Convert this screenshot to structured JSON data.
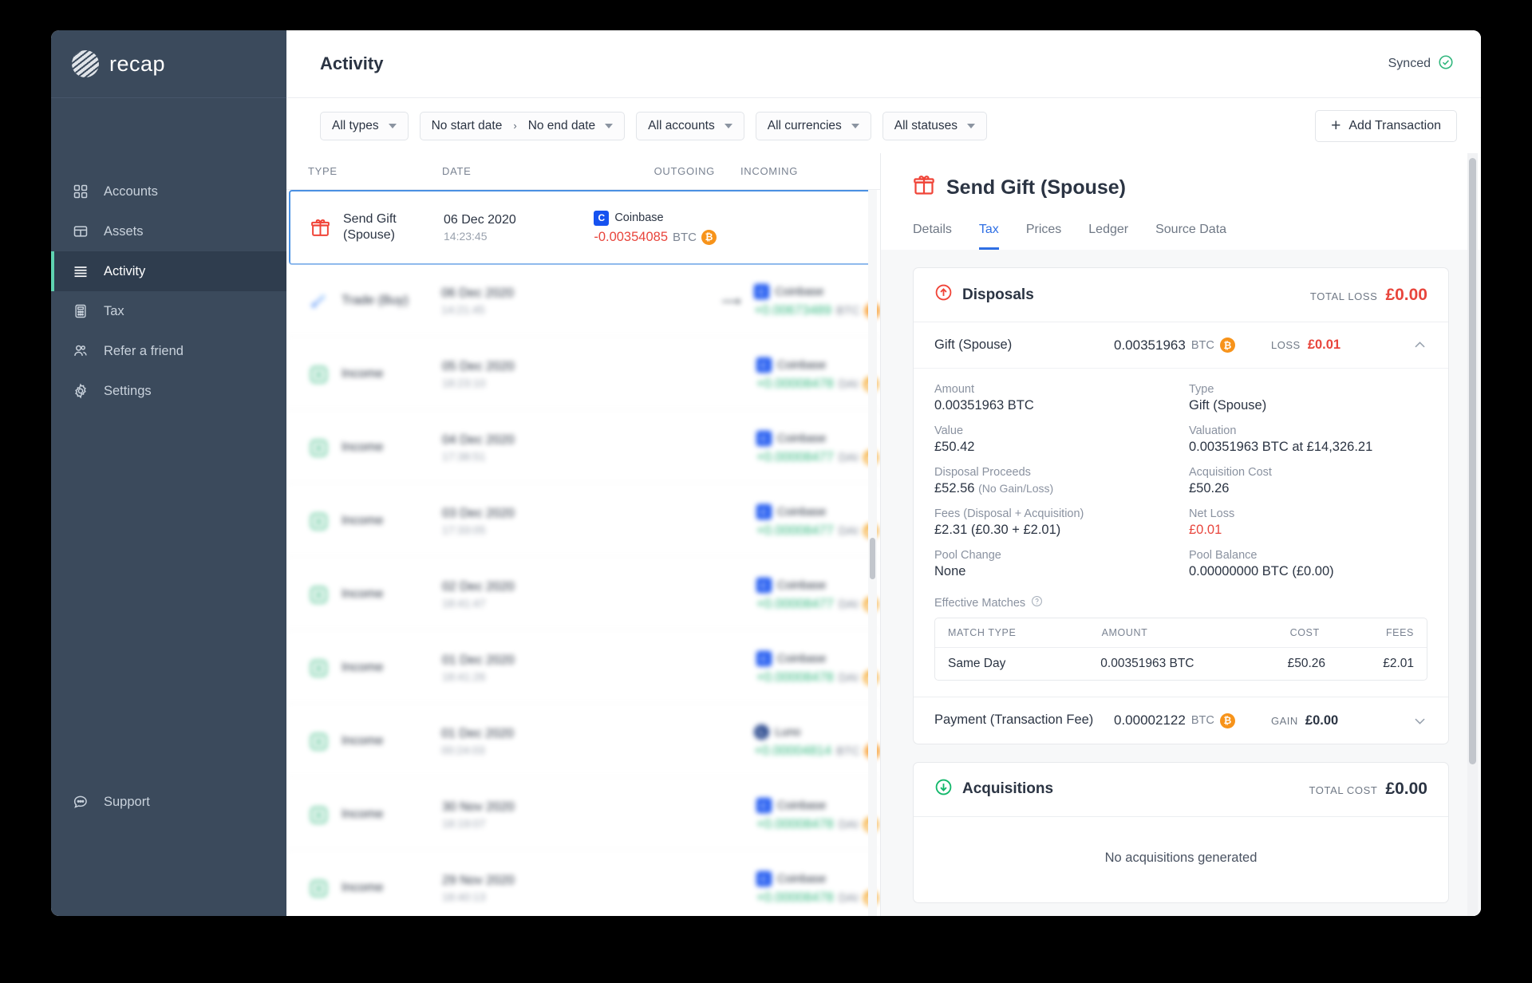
{
  "brand": {
    "name": "recap"
  },
  "sidebar": {
    "items": [
      {
        "label": "Accounts",
        "icon": "grid-icon",
        "active": false
      },
      {
        "label": "Assets",
        "icon": "table-icon",
        "active": false
      },
      {
        "label": "Activity",
        "icon": "list-icon",
        "active": true
      },
      {
        "label": "Tax",
        "icon": "calculator-icon",
        "active": false
      },
      {
        "label": "Refer a friend",
        "icon": "users-icon",
        "active": false
      },
      {
        "label": "Settings",
        "icon": "gear-icon",
        "active": false
      }
    ],
    "support": {
      "label": "Support",
      "icon": "chat-icon"
    }
  },
  "topbar": {
    "title": "Activity",
    "sync_label": "Synced",
    "sync_icon": "check-circle-icon"
  },
  "filters": {
    "types": "All types",
    "date_start": "No start date",
    "date_sep": "›",
    "date_end": "No end date",
    "accounts": "All accounts",
    "currencies": "All currencies",
    "statuses": "All statuses",
    "add_transaction": "Add Transaction",
    "plus": "+"
  },
  "tx_table": {
    "headers": {
      "type": "TYPE",
      "date": "DATE",
      "outgoing": "OUTGOING",
      "incoming": "INCOMING"
    },
    "rows": [
      {
        "selected": true,
        "blurred": false,
        "type": "Send Gift\n(Spouse)",
        "type_icon": "gift-icon",
        "date": "06 Dec 2020",
        "time": "14:23:45",
        "out": {
          "account": "Coinbase",
          "account_badge": "C",
          "amount": "-0.00354085",
          "currency": "BTC",
          "coin": "btc",
          "sign": "neg"
        },
        "in": null,
        "arrow": false
      },
      {
        "selected": false,
        "blurred": true,
        "type": "Trade (Buy)",
        "type_icon": "trade-icon",
        "date": "06 Dec 2020",
        "time": "14:21:45",
        "out": null,
        "arrow": true,
        "in": {
          "account": "Coinbase",
          "account_badge": "C",
          "amount": "+0.00673489",
          "currency": "BTC",
          "coin": "btc",
          "sign": "pos"
        }
      },
      {
        "selected": false,
        "blurred": true,
        "type": "Income",
        "type_icon": "income-icon",
        "date": "05 Dec 2020",
        "time": "18:23:10",
        "out": null,
        "arrow": false,
        "in": {
          "account": "Coinbase",
          "account_badge": "C",
          "amount": "+0.00008478",
          "currency": "DAI",
          "coin": "dai",
          "sign": "pos"
        }
      },
      {
        "selected": false,
        "blurred": true,
        "type": "Income",
        "type_icon": "income-icon",
        "date": "04 Dec 2020",
        "time": "17:38:51",
        "out": null,
        "arrow": false,
        "in": {
          "account": "Coinbase",
          "account_badge": "C",
          "amount": "+0.00008477",
          "currency": "DAI",
          "coin": "dai",
          "sign": "pos"
        }
      },
      {
        "selected": false,
        "blurred": true,
        "type": "Income",
        "type_icon": "income-icon",
        "date": "03 Dec 2020",
        "time": "17:33:05",
        "out": null,
        "arrow": false,
        "in": {
          "account": "Coinbase",
          "account_badge": "C",
          "amount": "+0.00008477",
          "currency": "DAI",
          "coin": "dai",
          "sign": "pos"
        }
      },
      {
        "selected": false,
        "blurred": true,
        "type": "Income",
        "type_icon": "income-icon",
        "date": "02 Dec 2020",
        "time": "18:41:47",
        "out": null,
        "arrow": false,
        "in": {
          "account": "Coinbase",
          "account_badge": "C",
          "amount": "+0.00008477",
          "currency": "DAI",
          "coin": "dai",
          "sign": "pos"
        }
      },
      {
        "selected": false,
        "blurred": true,
        "type": "Income",
        "type_icon": "income-icon",
        "date": "01 Dec 2020",
        "time": "18:41:26",
        "out": null,
        "arrow": false,
        "in": {
          "account": "Coinbase",
          "account_badge": "C",
          "amount": "+0.00008478",
          "currency": "DAI",
          "coin": "dai",
          "sign": "pos"
        }
      },
      {
        "selected": false,
        "blurred": true,
        "type": "Income",
        "type_icon": "income-icon",
        "date": "01 Dec 2020",
        "time": "00:24:03",
        "out": null,
        "arrow": false,
        "in": {
          "account": "Luno",
          "account_badge": "L",
          "amount": "+0.00004814",
          "currency": "BTC",
          "coin": "btc",
          "sign": "pos"
        }
      },
      {
        "selected": false,
        "blurred": true,
        "type": "Income",
        "type_icon": "income-icon",
        "date": "30 Nov 2020",
        "time": "18:19:07",
        "out": null,
        "arrow": false,
        "in": {
          "account": "Coinbase",
          "account_badge": "C",
          "amount": "+0.00008478",
          "currency": "DAI",
          "coin": "dai",
          "sign": "pos"
        }
      },
      {
        "selected": false,
        "blurred": true,
        "type": "Income",
        "type_icon": "income-icon",
        "date": "29 Nov 2020",
        "time": "18:40:13",
        "out": null,
        "arrow": false,
        "in": {
          "account": "Coinbase",
          "account_badge": "C",
          "amount": "+0.00008478",
          "currency": "DAI",
          "coin": "dai",
          "sign": "pos"
        }
      }
    ]
  },
  "detail": {
    "title": "Send Gift (Spouse)",
    "title_icon": "gift-icon",
    "tabs": [
      {
        "label": "Details",
        "active": false
      },
      {
        "label": "Tax",
        "active": true
      },
      {
        "label": "Prices",
        "active": false
      },
      {
        "label": "Ledger",
        "active": false
      },
      {
        "label": "Source Data",
        "active": false
      }
    ],
    "disposals": {
      "heading": "Disposals",
      "icon": "arrow-up-circle-icon",
      "total_label": "TOTAL LOSS",
      "total_value": "£0.00",
      "rows": [
        {
          "name": "Gift (Spouse)",
          "amount": "0.00351963",
          "unit": "BTC",
          "coin": "btc",
          "pl_label": "LOSS",
          "pl_value": "£0.01",
          "pl_kind": "red",
          "expanded": true,
          "fields": [
            {
              "k": "Amount",
              "v": "0.00351963 BTC"
            },
            {
              "k": "Type",
              "v": "Gift (Spouse)"
            },
            {
              "k": "Value",
              "v": "£50.42"
            },
            {
              "k": "Valuation",
              "v": "0.00351963 BTC at £14,326.21"
            },
            {
              "k": "Disposal Proceeds",
              "v": "£52.56",
              "v_muted": "(No Gain/Loss)"
            },
            {
              "k": "Acquisition Cost",
              "v": "£50.26"
            },
            {
              "k": "Fees (Disposal + Acquisition)",
              "v": "£2.31 (£0.30 + £2.01)"
            },
            {
              "k": "Net Loss",
              "v": "£0.01",
              "red": true
            },
            {
              "k": "Pool Change",
              "v": "None"
            },
            {
              "k": "Pool Balance",
              "v": "0.00000000 BTC (£0.00)"
            }
          ],
          "matches": {
            "label": "Effective Matches",
            "help_icon": "question-circle-icon",
            "headers": [
              "MATCH TYPE",
              "AMOUNT",
              "COST",
              "FEES"
            ],
            "rows": [
              [
                "Same Day",
                "0.00351963 BTC",
                "£50.26",
                "£2.01"
              ]
            ]
          }
        },
        {
          "name": "Payment (Transaction Fee)",
          "amount": "0.00002122",
          "unit": "BTC",
          "coin": "btc",
          "pl_label": "GAIN",
          "pl_value": "£0.00",
          "pl_kind": "dark",
          "expanded": false
        }
      ]
    },
    "acquisitions": {
      "heading": "Acquisitions",
      "icon": "arrow-down-circle-icon",
      "total_label": "TOTAL COST",
      "total_value": "£0.00",
      "empty": "No acquisitions generated"
    }
  },
  "colors": {
    "sidebar_bg": "#3b4a5c",
    "sidebar_active_bg": "#2f3d4e",
    "accent_green": "#5fd3b1",
    "tab_active": "#2f6fe4",
    "loss_red": "#e8453c",
    "gain_green": "#2fb67c",
    "btc_orange": "#f7931a",
    "dai_yellow": "#f5ac37",
    "coinbase_blue": "#1652f0",
    "selected_border": "#4a90e2"
  }
}
